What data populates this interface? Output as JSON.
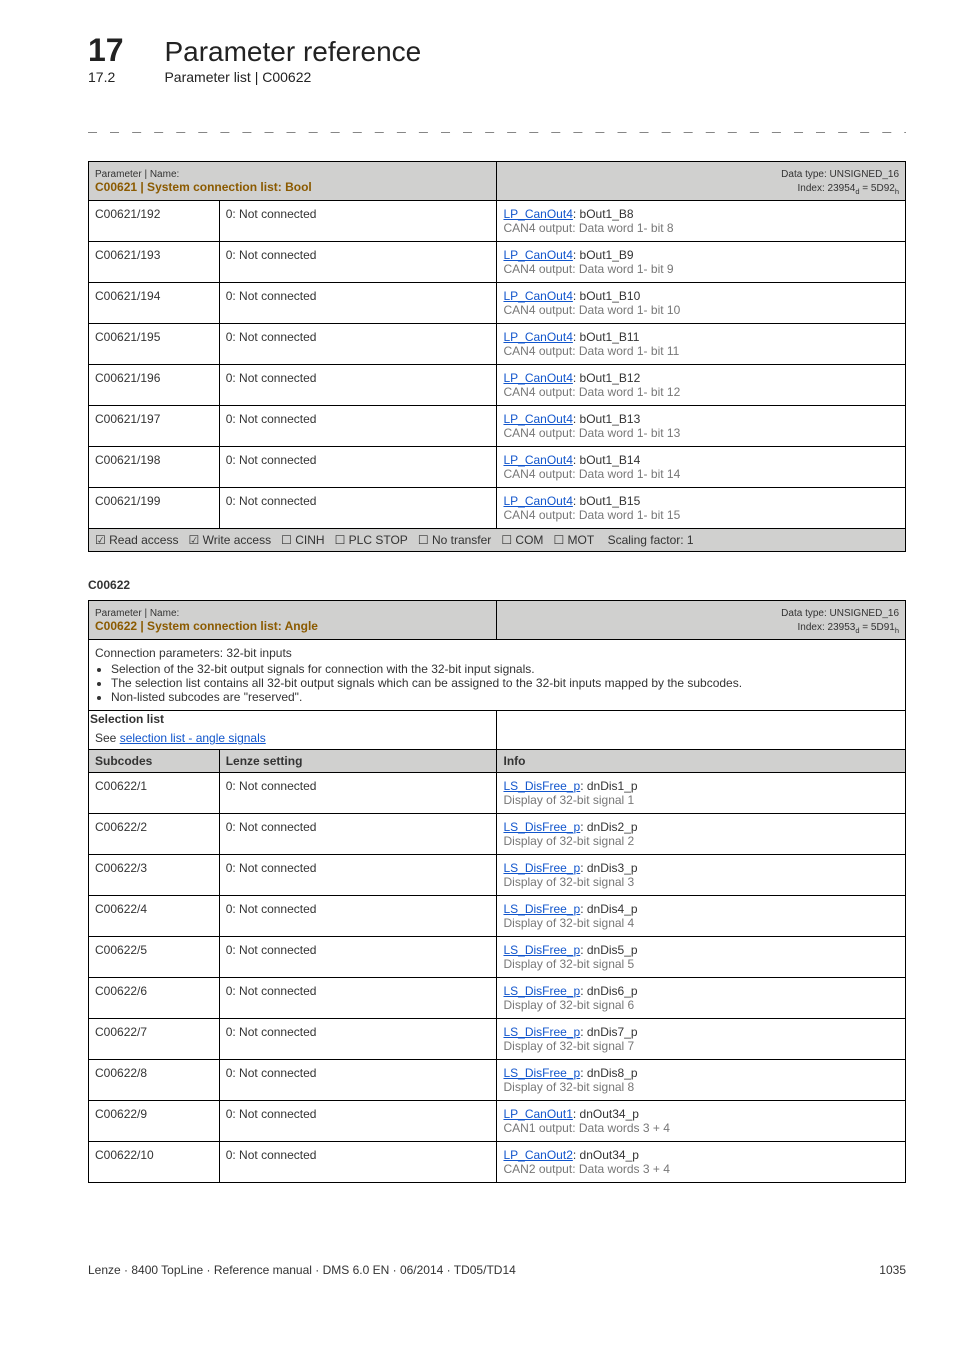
{
  "chapter": {
    "num": "17",
    "title": "Parameter reference"
  },
  "sub": {
    "num": "17.2",
    "title": "Parameter list | C00622"
  },
  "dashes": "_ _ _ _ _ _ _ _ _ _ _ _ _ _ _ _ _ _ _ _ _ _ _ _ _ _ _ _ _ _ _ _ _ _ _ _ _ _ _ _ _ _ _ _ _ _ _ _ _ _ _ _ _ _ _ _ _ _ _ _ _ _ _ _",
  "t1": {
    "hdr_small_left": "Parameter | Name:",
    "hdr_name": "C00621 | System connection list: Bool",
    "hdr_small_right": "Data type: UNSIGNED_16",
    "hdr_index": {
      "prefix": "Index: 23954",
      "sub1": "d",
      "mid": " = 5D92",
      "sub2": "h"
    },
    "rows": [
      {
        "a": "C00621/192",
        "b": "0: Not connected",
        "link": "LP_CanOut4",
        "after": ": bOut1_B8",
        "grey": "CAN4 output: Data word 1- bit 8"
      },
      {
        "a": "C00621/193",
        "b": "0: Not connected",
        "link": "LP_CanOut4",
        "after": ": bOut1_B9",
        "grey": "CAN4 output: Data word 1- bit 9"
      },
      {
        "a": "C00621/194",
        "b": "0: Not connected",
        "link": "LP_CanOut4",
        "after": ": bOut1_B10",
        "grey": "CAN4 output: Data word 1- bit 10"
      },
      {
        "a": "C00621/195",
        "b": "0: Not connected",
        "link": "LP_CanOut4",
        "after": ": bOut1_B11",
        "grey": "CAN4 output: Data word 1- bit 11"
      },
      {
        "a": "C00621/196",
        "b": "0: Not connected",
        "link": "LP_CanOut4",
        "after": ": bOut1_B12",
        "grey": "CAN4 output: Data word 1- bit 12"
      },
      {
        "a": "C00621/197",
        "b": "0: Not connected",
        "link": "LP_CanOut4",
        "after": ": bOut1_B13",
        "grey": "CAN4 output: Data word 1- bit 13"
      },
      {
        "a": "C00621/198",
        "b": "0: Not connected",
        "link": "LP_CanOut4",
        "after": ": bOut1_B14",
        "grey": "CAN4 output: Data word 1- bit 14"
      },
      {
        "a": "C00621/199",
        "b": "0: Not connected",
        "link": "LP_CanOut4",
        "after": ": bOut1_B15",
        "grey": "CAN4 output: Data word 1- bit 15"
      }
    ],
    "footer_parts": {
      "read": "Read access",
      "write": "Write access",
      "cinh": "CINH",
      "plc": "PLC STOP",
      "notr": "No transfer",
      "com": "COM",
      "mot": "MOT",
      "scale": "Scaling factor: 1"
    }
  },
  "code_label": "C00622",
  "t2": {
    "hdr_small_left": "Parameter | Name:",
    "hdr_name": "C00622 | System connection list: Angle",
    "hdr_small_right": "Data type: UNSIGNED_16",
    "hdr_index": {
      "prefix": "Index: 23953",
      "sub1": "d",
      "mid": " = 5D91",
      "sub2": "h"
    },
    "notes": {
      "lead": "Connection parameters: 32-bit inputs",
      "b1": "Selection of the 32-bit output signals for connection with the 32-bit input signals.",
      "b2": "The selection list contains all 32-bit output signals which can be assigned to the 32-bit inputs mapped by the subcodes.",
      "b3": "Non-listed subcodes are \"reserved\"."
    },
    "selection_label": "Selection list",
    "selection_prefix": "See ",
    "selection_link": "selection list - angle signals",
    "col_a": "Subcodes",
    "col_b": "Lenze setting",
    "col_c": "Info",
    "rows": [
      {
        "a": "C00622/1",
        "b": "0: Not connected",
        "link": "LS_DisFree_p",
        "after": ": dnDis1_p",
        "grey": "Display of 32-bit signal 1"
      },
      {
        "a": "C00622/2",
        "b": "0: Not connected",
        "link": "LS_DisFree_p",
        "after": ": dnDis2_p",
        "grey": "Display of 32-bit signal 2"
      },
      {
        "a": "C00622/3",
        "b": "0: Not connected",
        "link": "LS_DisFree_p",
        "after": ": dnDis3_p",
        "grey": "Display of 32-bit signal 3"
      },
      {
        "a": "C00622/4",
        "b": "0: Not connected",
        "link": "LS_DisFree_p",
        "after": ": dnDis4_p",
        "grey": "Display of 32-bit signal 4"
      },
      {
        "a": "C00622/5",
        "b": "0: Not connected",
        "link": "LS_DisFree_p",
        "after": ": dnDis5_p",
        "grey": "Display of 32-bit signal 5"
      },
      {
        "a": "C00622/6",
        "b": "0: Not connected",
        "link": "LS_DisFree_p",
        "after": ": dnDis6_p",
        "grey": "Display of 32-bit signal 6"
      },
      {
        "a": "C00622/7",
        "b": "0: Not connected",
        "link": "LS_DisFree_p",
        "after": ": dnDis7_p",
        "grey": "Display of 32-bit signal 7"
      },
      {
        "a": "C00622/8",
        "b": "0: Not connected",
        "link": "LS_DisFree_p",
        "after": ": dnDis8_p",
        "grey": "Display of 32-bit signal 8"
      },
      {
        "a": "C00622/9",
        "b": "0: Not connected",
        "link": "LP_CanOut1",
        "after": ": dnOut34_p",
        "grey": "CAN1 output: Data words 3 + 4"
      },
      {
        "a": "C00622/10",
        "b": "0: Not connected",
        "link": "LP_CanOut2",
        "after": ": dnOut34_p",
        "grey": "CAN2 output: Data words 3 + 4"
      }
    ]
  },
  "footer": {
    "left": "Lenze · 8400 TopLine · Reference manual · DMS 6.0 EN · 06/2014 · TD05/TD14",
    "right": "1035"
  },
  "sym": {
    "checked": "☑",
    "unchecked": "☐"
  }
}
